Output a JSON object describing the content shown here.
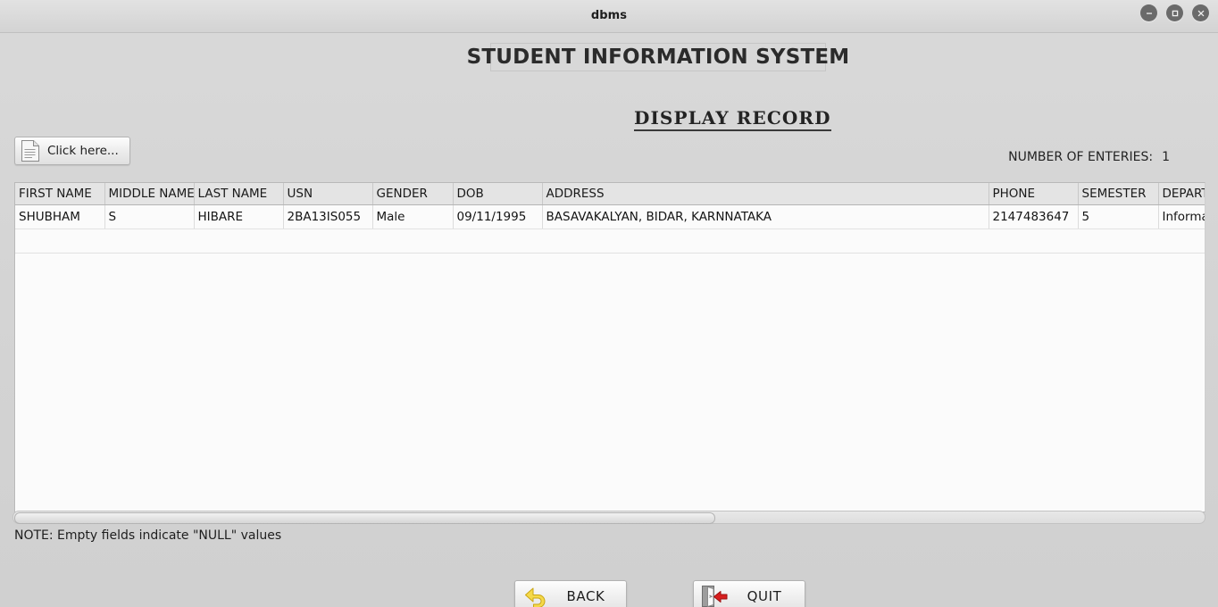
{
  "window": {
    "title": "dbms",
    "controls": [
      {
        "name": "minimize",
        "glyph": "minimize-icon"
      },
      {
        "name": "maximize",
        "glyph": "maximize-icon"
      },
      {
        "name": "close",
        "glyph": "close-icon"
      }
    ]
  },
  "header": {
    "app_title": "STUDENT INFORMATION SYSTEM",
    "section_title": "DISPLAY RECORD"
  },
  "toolbar": {
    "click_here_label": "Click here...",
    "click_here_icon": "document-icon",
    "entries_label": "NUMBER OF ENTERIES:",
    "entries_count": "1"
  },
  "table": {
    "columns": [
      "FIRST NAME",
      "MIDDLE NAME",
      "LAST NAME",
      "USN",
      "GENDER",
      "DOB",
      "ADDRESS",
      "PHONE",
      "SEMESTER",
      "DEPARTMENT"
    ],
    "rows": [
      {
        "first_name": "SHUBHAM",
        "middle_name": "S",
        "last_name": "HIBARE",
        "usn": "2BA13IS055",
        "gender": "Male",
        "dob": "09/11/1995",
        "address": "BASAVAKALYAN, BIDAR, KARNNATAKA",
        "phone": "2147483647",
        "semester": "5",
        "department": "Information"
      }
    ]
  },
  "note": "NOTE: Empty fields indicate \"NULL\" values",
  "footer": {
    "back_label": "BACK",
    "back_icon": "back-arrow-icon",
    "quit_label": "QUIT",
    "quit_icon": "exit-door-icon"
  },
  "colors": {
    "background": "#d3d3d3",
    "header_row": "#e4e4e4",
    "row": "#fbfbfb",
    "back_icon": "#f2d33c",
    "quit_icon": "#d81f1f"
  }
}
